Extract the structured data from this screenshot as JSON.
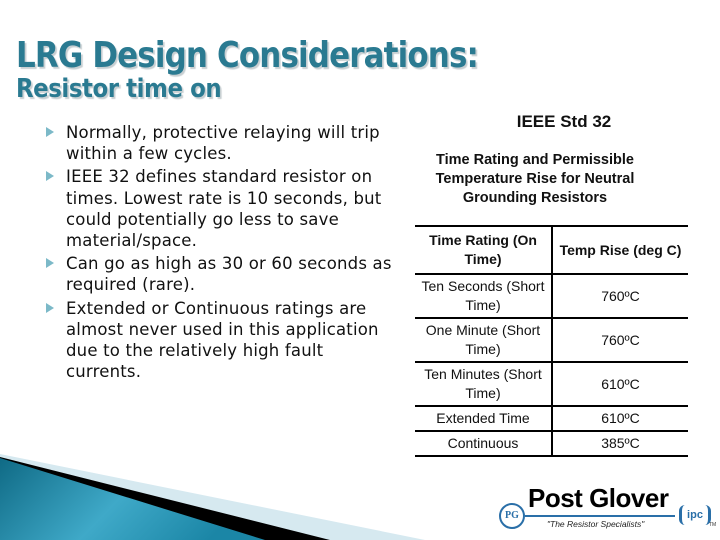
{
  "slide": {
    "title": "LRG Design Considerations:",
    "subtitle": "Resistor time on",
    "bullets": [
      "Normally, protective relaying will trip within a few cycles.",
      "IEEE 32 defines standard resistor on times.  Lowest rate is 10 seconds, but could potentially go less to save material/space.",
      "Can go as high as 30 or 60 seconds as required (rare).",
      "Extended or Continuous ratings are almost never used in this application due to the relatively high fault currents."
    ],
    "ieee": {
      "title": "IEEE Std 32",
      "subtitle": "Time Rating and Permissible Temperature Rise for Neutral Grounding Resistors"
    },
    "table": {
      "headers": [
        "Time Rating (On Time)",
        "Temp Rise (deg C)"
      ],
      "rows": [
        [
          "Ten Seconds (Short Time)",
          "760ºC"
        ],
        [
          "One Minute (Short Time)",
          "760ºC"
        ],
        [
          "Ten Minutes (Short Time)",
          "610ºC"
        ],
        [
          "Extended Time",
          "610ºC"
        ],
        [
          "Continuous",
          "385ºC"
        ]
      ]
    },
    "logo": {
      "name": "Post Glover",
      "tagline": "\"The Resistor Specialists\"",
      "pg_mark": "PG",
      "ipc_mark": "ipc",
      "tm": "TM"
    },
    "colors": {
      "title": "#2a7a91",
      "accent_teal": "#1f7f9c",
      "logo_blue": "#2a6fa8"
    }
  }
}
